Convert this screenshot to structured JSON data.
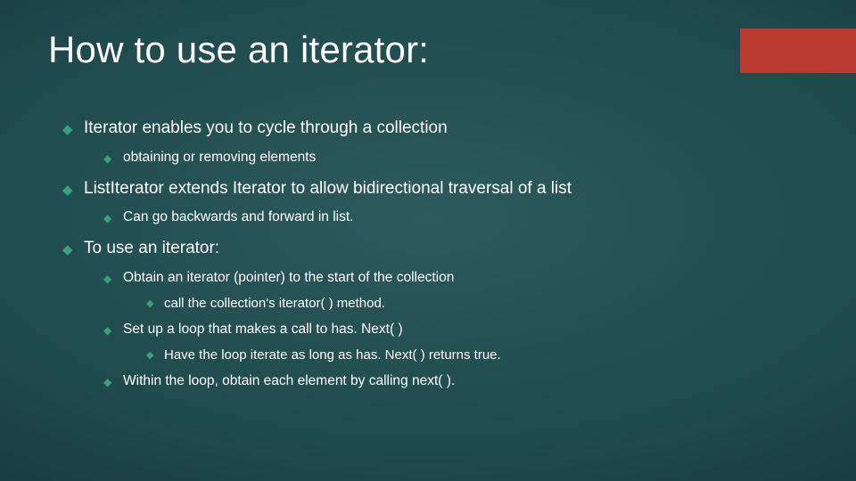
{
  "title": "How to use an iterator:",
  "bullets": {
    "b1": "Iterator enables you to cycle through a collection",
    "b1_1": "obtaining or removing elements",
    "b2": "ListIterator extends Iterator to allow bidirectional traversal of a list",
    "b2_1": "Can go backwards and forward in list.",
    "b3": "To use an iterator:",
    "b3_1": "Obtain an iterator (pointer) to the start of the collection",
    "b3_1_1": "call the collection's iterator( ) method.",
    "b3_2": "Set up a loop that makes a call to has. Next( )",
    "b3_2_1": "Have the loop iterate as long as has. Next( ) returns true.",
    "b3_3": "Within the loop, obtain each element by calling next( )."
  }
}
